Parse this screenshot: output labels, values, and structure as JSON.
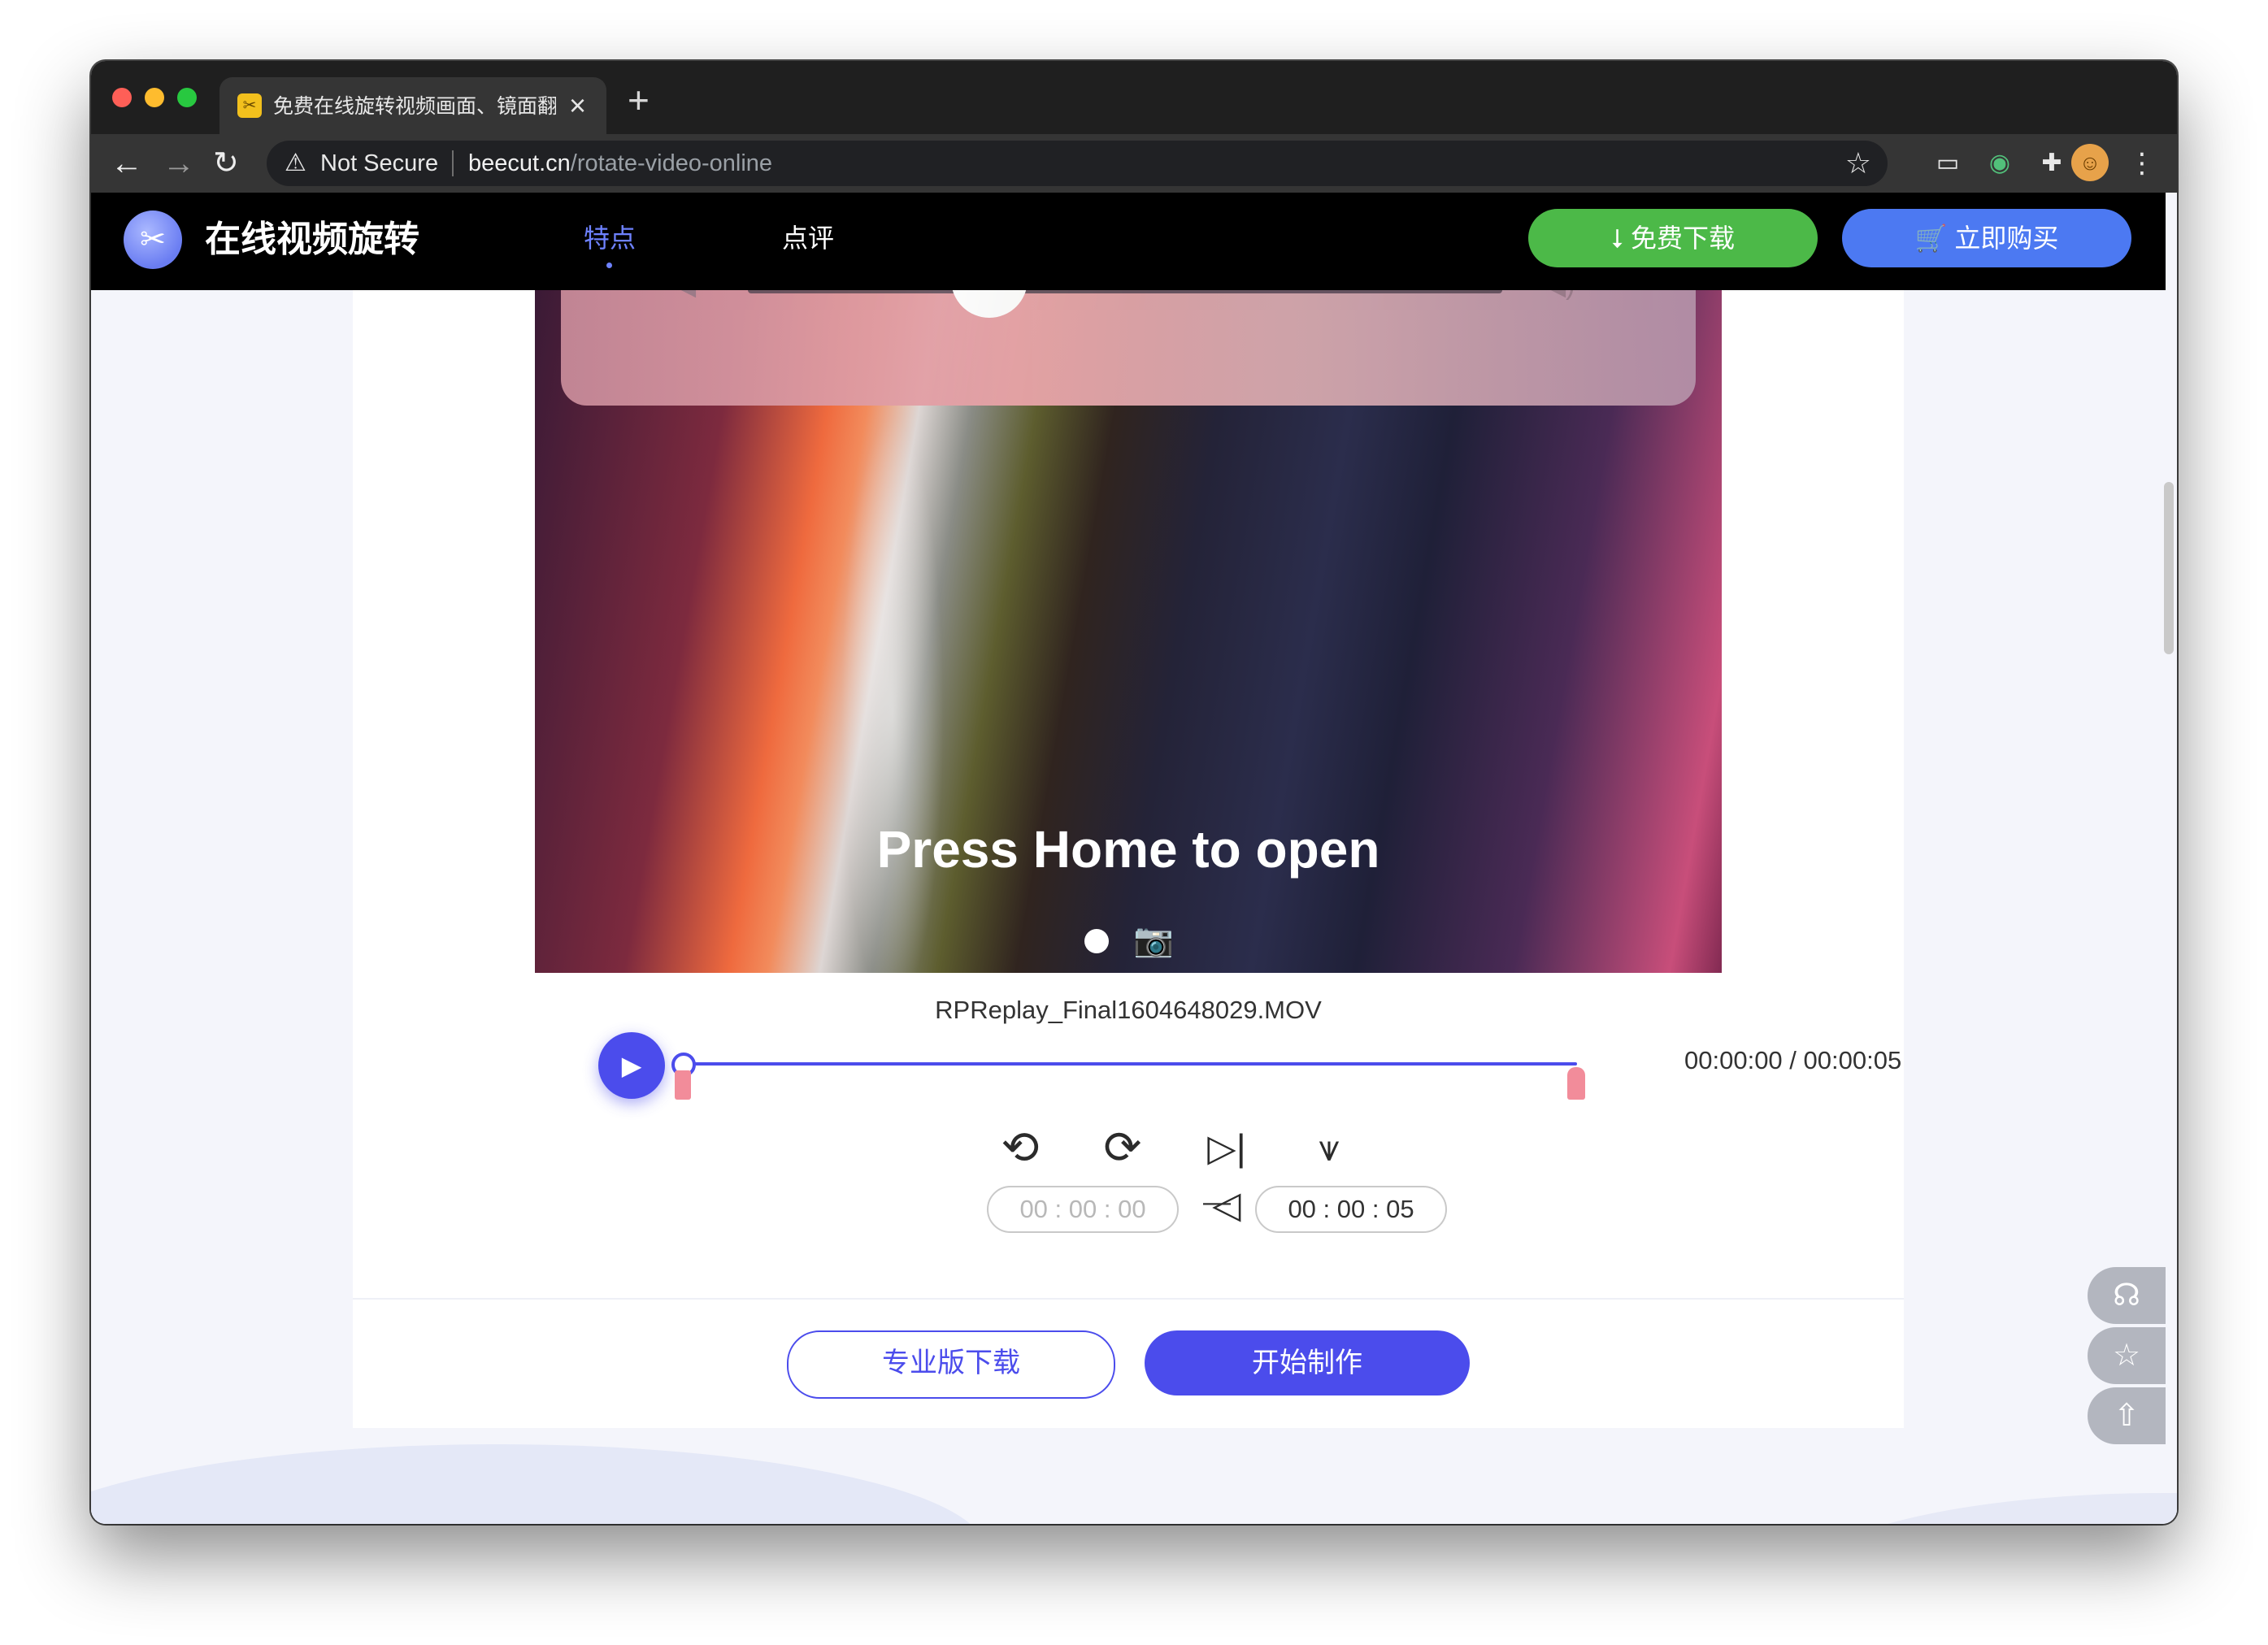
{
  "browser": {
    "tab_title": "免费在线旋转视频画面、镜面翻转",
    "tab_close": "×",
    "new_tab": "+",
    "security_label": "Not Secure",
    "url_host": "beecut.cn",
    "url_path": "/rotate-video-online"
  },
  "header": {
    "site_title": "在线视频旋转",
    "nav": [
      "特点",
      "点评"
    ],
    "download_label": "⭣ 免费下载",
    "buy_label": "🛒 立即购买"
  },
  "player": {
    "caption": "Press Home to open",
    "filename": "RPReplay_Final1604648029.MOV",
    "time_readout": "00:00:00 / 00:00:05",
    "playback_progress": 0,
    "trim_start": "00 : 00 : 00",
    "trim_end": "00 : 00 : 05",
    "range_dash": "—"
  },
  "actions": {
    "pro_download": "专业版下载",
    "start": "开始制作"
  },
  "colors": {
    "accent": "#4b4cec",
    "download_green": "#4cb948",
    "buy_blue": "#4c79f2",
    "trim_marker": "#f28c9a"
  }
}
